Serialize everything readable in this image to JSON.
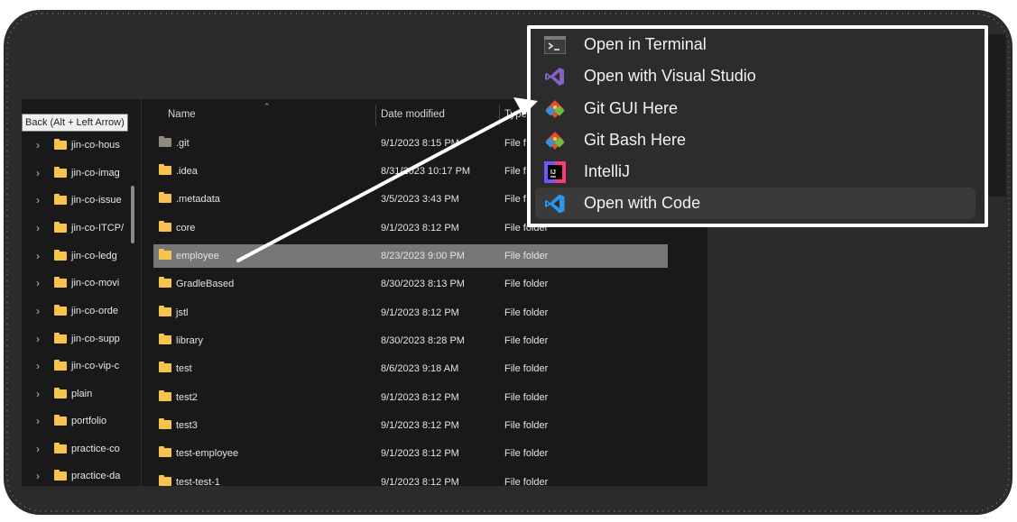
{
  "explorer": {
    "tooltip": "Back (Alt + Left Arrow)",
    "nav_items": [
      {
        "label": "jin-co-hous"
      },
      {
        "label": "jin-co-imag"
      },
      {
        "label": "jin-co-issue"
      },
      {
        "label": "jin-co-ITCP/"
      },
      {
        "label": "jin-co-ledg"
      },
      {
        "label": "jin-co-movi"
      },
      {
        "label": "jin-co-orde"
      },
      {
        "label": "jin-co-supp"
      },
      {
        "label": "jin-co-vip-c"
      },
      {
        "label": "plain"
      },
      {
        "label": "portfolio"
      },
      {
        "label": "practice-co"
      },
      {
        "label": "practice-da"
      }
    ],
    "columns": {
      "name": "Name",
      "date": "Date modified",
      "type": "Type"
    },
    "rows": [
      {
        "name": ".git",
        "date": "9/1/2023 8:15 PM",
        "type": "File f"
      },
      {
        "name": ".idea",
        "date": "8/31/2023 10:17 PM",
        "type": "File f"
      },
      {
        "name": ".metadata",
        "date": "3/5/2023 3:43 PM",
        "type": "File f"
      },
      {
        "name": "core",
        "date": "9/1/2023 8:12 PM",
        "type": "File folder"
      },
      {
        "name": "employee",
        "date": "8/23/2023 9:00 PM",
        "type": "File folder"
      },
      {
        "name": "GradleBased",
        "date": "8/30/2023 8:13 PM",
        "type": "File folder"
      },
      {
        "name": "jstl",
        "date": "9/1/2023 8:12 PM",
        "type": "File folder"
      },
      {
        "name": "library",
        "date": "8/30/2023 8:28 PM",
        "type": "File folder"
      },
      {
        "name": "test",
        "date": "8/6/2023 9:18 AM",
        "type": "File folder"
      },
      {
        "name": "test2",
        "date": "9/1/2023 8:12 PM",
        "type": "File folder"
      },
      {
        "name": "test3",
        "date": "9/1/2023 8:12 PM",
        "type": "File folder"
      },
      {
        "name": "test-employee",
        "date": "9/1/2023 8:12 PM",
        "type": "File folder"
      },
      {
        "name": "test-test-1",
        "date": "9/1/2023 8:12 PM",
        "type": "File folder"
      }
    ]
  },
  "context_menu": {
    "items": [
      {
        "label": "Open in Terminal",
        "icon": "terminal-icon"
      },
      {
        "label": "Open with Visual Studio",
        "icon": "visual-studio-icon"
      },
      {
        "label": "Git GUI Here",
        "icon": "git-icon"
      },
      {
        "label": "Git Bash Here",
        "icon": "git-icon"
      },
      {
        "label": "IntelliJ",
        "icon": "intellij-icon"
      },
      {
        "label": "Open with Code",
        "icon": "vscode-icon"
      }
    ]
  },
  "colors": {
    "frame": "#2b2b2b",
    "explorer_bg": "#191919",
    "selected_row": "#777777",
    "folder": "#f6c44e",
    "menu_bg": "#2c2c2c",
    "menu_border": "#ffffff",
    "arrow": "#ffffff"
  }
}
